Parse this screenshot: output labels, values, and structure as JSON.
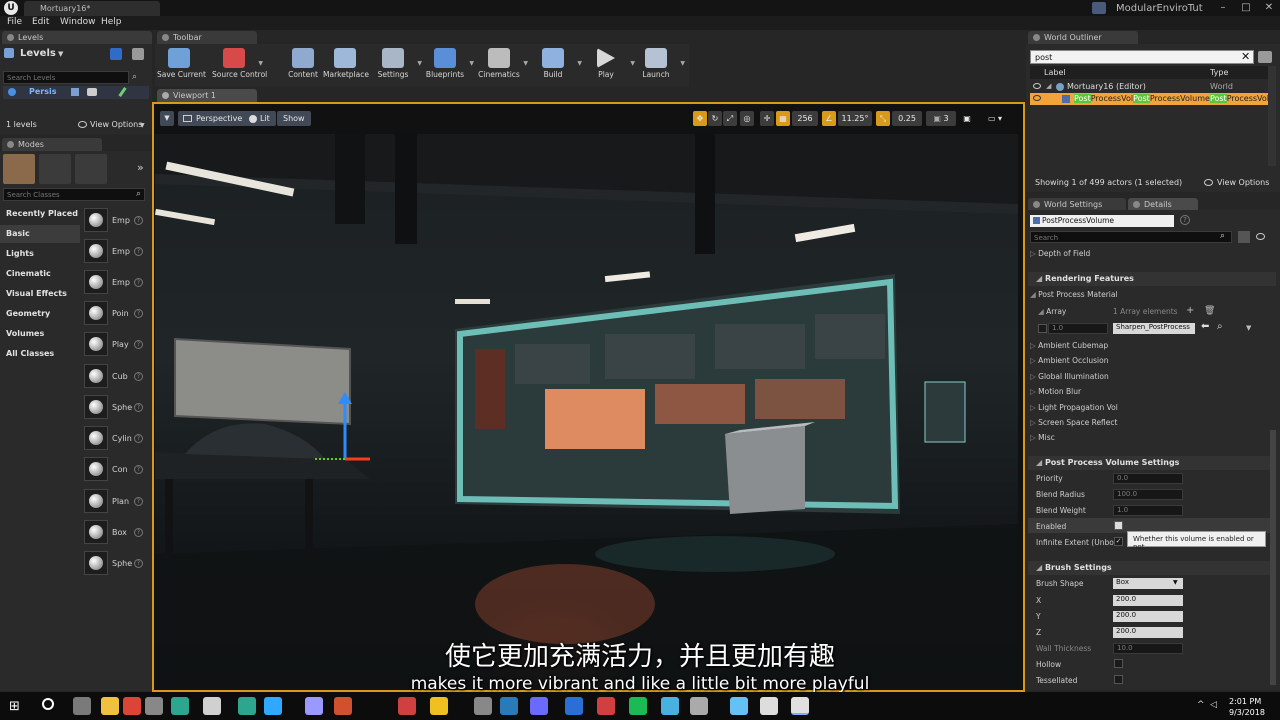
{
  "title_bar": {
    "doc_tab": "Mortuary16*",
    "project": "ModularEnviroTut"
  },
  "menu": {
    "items": [
      "File",
      "Edit",
      "Window",
      "Help"
    ]
  },
  "tabs": {
    "levels": "Levels",
    "toolbar": "Toolbar",
    "viewport": "Viewport 1",
    "modes": "Modes",
    "outliner": "World Outliner",
    "world_settings": "World Settings",
    "details": "Details"
  },
  "levels": {
    "title": "Levels",
    "search_placeholder": "Search Levels",
    "persistent_label": "Persis",
    "count": "1 levels",
    "view_options": "View Options"
  },
  "modes": {
    "search_placeholder": "Search Classes",
    "categories": [
      "Recently Placed",
      "Basic",
      "Lights",
      "Cinematic",
      "Visual Effects",
      "Geometry",
      "Volumes",
      "All Classes"
    ],
    "selected_category": "Basic",
    "items": [
      "Emp",
      "Emp",
      "Emp",
      "Poin",
      "Play",
      "Cub",
      "Sphe",
      "Cylin",
      "Con",
      "Plan",
      "Box",
      "Sphe"
    ]
  },
  "toolbar": {
    "buttons": [
      "Save Current",
      "Source Control",
      "Content",
      "Marketplace",
      "Settings",
      "Blueprints",
      "Cinematics",
      "Build",
      "Play",
      "Launch"
    ],
    "icon_colors": [
      "#6fa0d8",
      "#d84a4a",
      "#8fa9cf",
      "#9db8d8",
      "#a8b6c8",
      "#5a8fd8",
      "#bcbcbc",
      "#8fb1e0",
      "#d8d8d8",
      "#b5c2d4"
    ]
  },
  "viewport": {
    "perspective": "Perspective",
    "lit": "Lit",
    "show": "Show",
    "grid_snap": "256",
    "rot_snap": "11.25°",
    "scale_snap": "0.25",
    "cam_speed": "3",
    "accent": "#d99a1a"
  },
  "outliner": {
    "search_value": "post",
    "col_label": "Label",
    "col_type": "Type",
    "rows": [
      {
        "label": "Mortuary16 (Editor)",
        "type": "World"
      },
      {
        "label_parts": [
          "Post",
          "ProcessVol",
          "Post",
          "ProcessVolume",
          "Post",
          "ProcessVolu"
        ],
        "highlight": "#5ec43a"
      }
    ],
    "footer": "Showing 1 of 499 actors (1 selected)",
    "view_options": "View Options"
  },
  "details": {
    "object_name": "PostProcessVolume",
    "search_placeholder": "Search",
    "rows_top": [
      "Depth of Field"
    ],
    "rendering_features": {
      "header": "Rendering Features",
      "post_process_material": "Post Process Material",
      "array_label": "Array",
      "array_elements": "1 Array elements",
      "array_weight": "1.0",
      "array_material": "Sharpen_PostProcess",
      "subitems": [
        "Ambient Cubemap",
        "Ambient Occlusion",
        "Global Illumination",
        "Motion Blur",
        "Light Propagation Vol",
        "Screen Space Reflect",
        "Misc"
      ]
    },
    "ppv_settings": {
      "header": "Post Process Volume Settings",
      "priority_label": "Priority",
      "priority": "0.0",
      "blend_radius_label": "Blend Radius",
      "blend_radius": "100.0",
      "blend_weight_label": "Blend Weight",
      "blend_weight": "1.0",
      "enabled_label": "Enabled",
      "infinite_label": "Infinite Extent (Unbour"
    },
    "tooltip": "Whether this volume is enabled or not.",
    "brush": {
      "header": "Brush Settings",
      "shape_label": "Brush Shape",
      "shape": "Box",
      "x_label": "X",
      "x": "200.0",
      "y_label": "Y",
      "y": "200.0",
      "z_label": "Z",
      "z": "200.0",
      "wall_label": "Wall Thickness",
      "wall": "10.0",
      "hollow_label": "Hollow",
      "tess_label": "Tessellated"
    }
  },
  "subtitles": {
    "zh": "使它更加充满活力，并且更加有趣",
    "en": "makes it more vibrant and like a little bit more playful"
  },
  "taskbar": {
    "time": "2:01 PM",
    "date": "9/3/2018",
    "app_colors": [
      "#7a7a7a",
      "#f0c040",
      "#db4437",
      "#888",
      "#2ea58e",
      "#d0d0d0",
      "#2ea58e",
      "#31a8ff",
      "#9999ff",
      "#d05030",
      "#d04040",
      "#f0c020",
      "#888",
      "#2a7ab8",
      "#6a6aff",
      "#2c6fd4",
      "#d04040",
      "#1db954",
      "#4ab0e0",
      "#aaa",
      "#66c0f4",
      "#ddd",
      "#e0e0e0"
    ]
  }
}
